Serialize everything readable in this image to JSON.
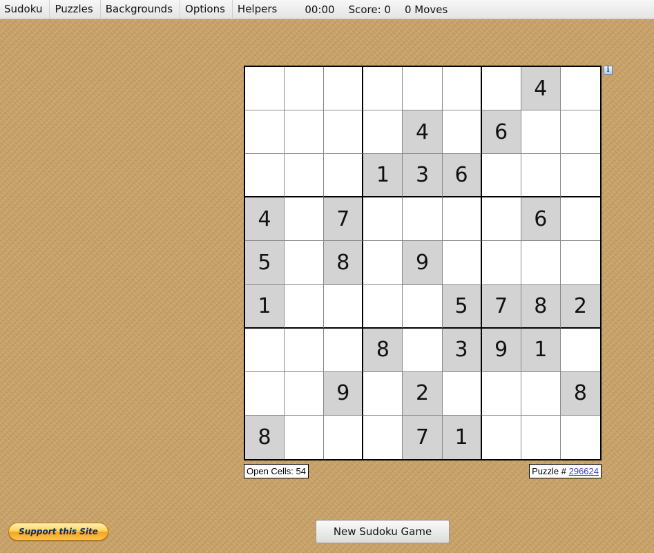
{
  "menu": {
    "items": [
      "Sudoku",
      "Puzzles",
      "Backgrounds",
      "Options",
      "Helpers"
    ],
    "timer": "00:00",
    "score": "Score: 0",
    "moves": "0 Moves"
  },
  "board": {
    "cells": [
      [
        "",
        "",
        "",
        "",
        "",
        "",
        "",
        "4",
        ""
      ],
      [
        "",
        "",
        "",
        "",
        "4",
        "",
        "6",
        "",
        ""
      ],
      [
        "",
        "",
        "",
        "1",
        "3",
        "6",
        "",
        "",
        ""
      ],
      [
        "4",
        "",
        "7",
        "",
        "",
        "",
        "",
        "6",
        ""
      ],
      [
        "5",
        "",
        "8",
        "",
        "9",
        "",
        "",
        "",
        ""
      ],
      [
        "1",
        "",
        "",
        "",
        "",
        "5",
        "7",
        "8",
        "2"
      ],
      [
        "",
        "",
        "",
        "8",
        "",
        "3",
        "9",
        "1",
        ""
      ],
      [
        "",
        "",
        "9",
        "",
        "2",
        "",
        "",
        "",
        "8"
      ],
      [
        "8",
        "",
        "",
        "",
        "7",
        "1",
        "",
        "",
        ""
      ]
    ]
  },
  "footer": {
    "open_cells_label": "Open Cells: 54",
    "puzzle_label": "Puzzle # ",
    "puzzle_number": "296624"
  },
  "buttons": {
    "new_game": "New Sudoku Game",
    "support": "Support this Site"
  },
  "icons": {
    "info": "info-icon",
    "info_glyph": "i"
  },
  "colors": {
    "given_cell": "#d3d3d3",
    "empty_cell": "#ffffff",
    "background": "#c9a26a"
  }
}
